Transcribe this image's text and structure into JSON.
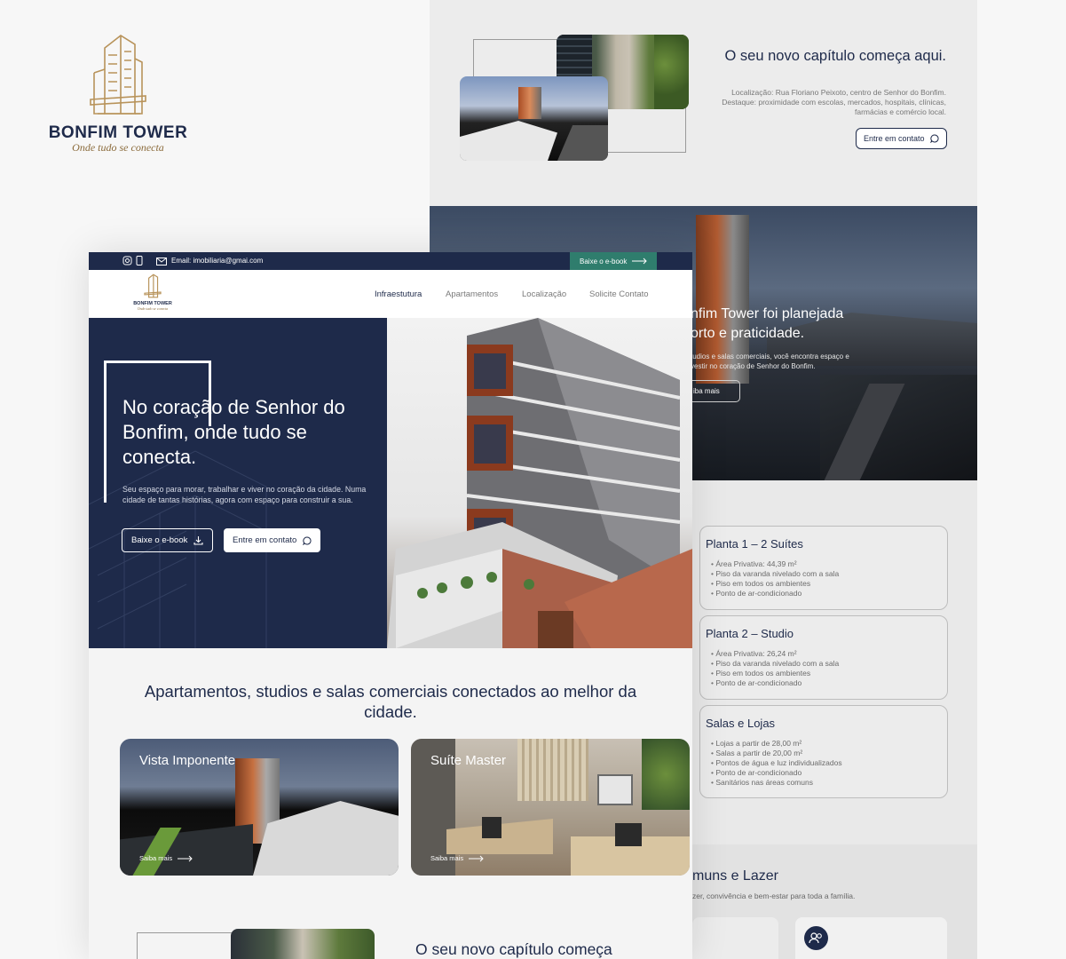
{
  "brand": {
    "name": "BONFIM TOWER",
    "tagline": "Onde tudo se conecta"
  },
  "back_section": {
    "title": "O seu novo capítulo começa aqui.",
    "location": "Localização: Rua Floriano Peixoto, centro de Senhor do Bonfim.",
    "highlight": "Destaque: proximidade com escolas, mercados, hospitais, clínicas, farmácias e comércio local.",
    "cta": "Entre em contato"
  },
  "back_hero": {
    "title_line1": "nfim Tower foi planejada",
    "title_line2": "orto e praticidade.",
    "text_line1": "tudios e salas comerciais, você encontra espaço e",
    "text_line2": "vestir no coração de Senhor do Bonfim.",
    "button": "iba mais"
  },
  "plans": [
    {
      "title": "Planta 1 – 2 Suítes",
      "items": [
        "Área Privativa: 44,39 m²",
        "Piso da varanda nivelado com a sala",
        "Piso em todos os ambientes",
        "Ponto de ar-condicionado"
      ]
    },
    {
      "title": "Planta 2 – Studio",
      "items": [
        "Área Privativa: 26,24 m²",
        "Piso da varanda nivelado com a sala",
        "Piso em todos os ambientes",
        "Ponto de ar-condicionado"
      ]
    },
    {
      "title": "Salas e Lojas",
      "items": [
        "Lojas a partir de 28,00 m²",
        "Salas a partir de 20,00 m²",
        "Pontos de água e luz individualizados",
        "Ponto de ar-condicionado",
        "Sanitários nas áreas comuns"
      ]
    }
  ],
  "back_bottom": {
    "title": "muns e Lazer",
    "text": "zer, convivência e bem-estar para toda a família."
  },
  "topbar": {
    "email": "Email: imobiliaria@gmai.com",
    "ebook_button": "Baixe o e-book"
  },
  "nav": {
    "items": [
      "Infraestutura",
      "Apartamentos",
      "Localização",
      "Solicite Contato"
    ]
  },
  "hero": {
    "title": "No coração de Senhor do Bonfim, onde tudo se conecta.",
    "subtitle": "Seu espaço para morar, trabalhar e viver no coração da cidade. Numa cidade de tantas histórias, agora com espaço para construir a sua.",
    "ebook_button": "Baixe o e-book",
    "contact_button": "Entre em contato"
  },
  "section2": {
    "title": "Apartamentos, studios e salas comerciais conectados ao melhor da cidade.",
    "cards": [
      {
        "title": "Vista Imponente",
        "link": "Saiba mais"
      },
      {
        "title": "Suíte Master",
        "link": "Saiba mais"
      }
    ]
  },
  "section3": {
    "title": "O seu novo capítulo começa"
  },
  "colors": {
    "navy": "#1e2a4a",
    "gold": "#b8935a",
    "accent_green": "#2f7d6d",
    "brick": "#8b3a1e"
  }
}
